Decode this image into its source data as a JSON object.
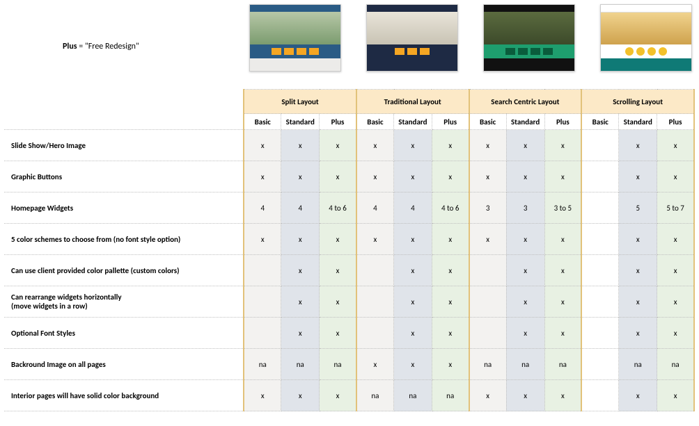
{
  "note_label": "Plus",
  "note_text": " = \"Free Redesign\"",
  "layouts": [
    "Split Layout",
    "Traditional Layout",
    "Search Centric Layout",
    "Scrolling Layout"
  ],
  "tiers": [
    "Basic",
    "Standard",
    "Plus"
  ],
  "chart_data": {
    "type": "table",
    "title": "Layout feature comparison",
    "columns": [
      "Split Layout / Basic",
      "Split Layout / Standard",
      "Split Layout / Plus",
      "Traditional Layout / Basic",
      "Traditional Layout / Standard",
      "Traditional Layout / Plus",
      "Search Centric Layout / Basic",
      "Search Centric Layout / Standard",
      "Search Centric Layout / Plus",
      "Scrolling Layout / Basic",
      "Scrolling Layout / Standard",
      "Scrolling Layout / Plus"
    ],
    "rows": [
      {
        "label": "Slide Show/Hero Image",
        "values": [
          "x",
          "x",
          "x",
          "x",
          "x",
          "x",
          "x",
          "x",
          "x",
          "",
          "x",
          "x"
        ]
      },
      {
        "label": "Graphic Buttons",
        "values": [
          "x",
          "x",
          "x",
          "x",
          "x",
          "x",
          "x",
          "x",
          "x",
          "",
          "x",
          "x"
        ]
      },
      {
        "label": "Homepage Widgets",
        "values": [
          "4",
          "4",
          "4 to 6",
          "4",
          "4",
          "4 to 6",
          "3",
          "3",
          "3 to 5",
          "",
          "5",
          "5 to 7"
        ]
      },
      {
        "label": "5 color schemes to choose from (no font style option)",
        "values": [
          "x",
          "x",
          "x",
          "x",
          "x",
          "x",
          "x",
          "x",
          "x",
          "",
          "x",
          "x"
        ]
      },
      {
        "label": "Can use client provided color pallette (custom colors)",
        "values": [
          "",
          "x",
          "x",
          "",
          "x",
          "x",
          "",
          "x",
          "x",
          "",
          "x",
          "x"
        ]
      },
      {
        "label": "Can rearrange widgets horizontally\n(move widgets in a row)",
        "values": [
          "",
          "x",
          "x",
          "",
          "x",
          "x",
          "",
          "x",
          "x",
          "",
          "x",
          "x"
        ]
      },
      {
        "label": "Optional Font Styles",
        "values": [
          "",
          "x",
          "x",
          "",
          "x",
          "x",
          "",
          "x",
          "x",
          "",
          "x",
          "x"
        ]
      },
      {
        "label": "Backround Image on all pages",
        "values": [
          "na",
          "na",
          "na",
          "x",
          "x",
          "x",
          "na",
          "na",
          "na",
          "",
          "na",
          "na"
        ]
      },
      {
        "label": "Interior pages will have solid color background",
        "values": [
          "x",
          "x",
          "x",
          "na",
          "na",
          "na",
          "x",
          "x",
          "x",
          "",
          "x",
          "x"
        ]
      }
    ]
  }
}
